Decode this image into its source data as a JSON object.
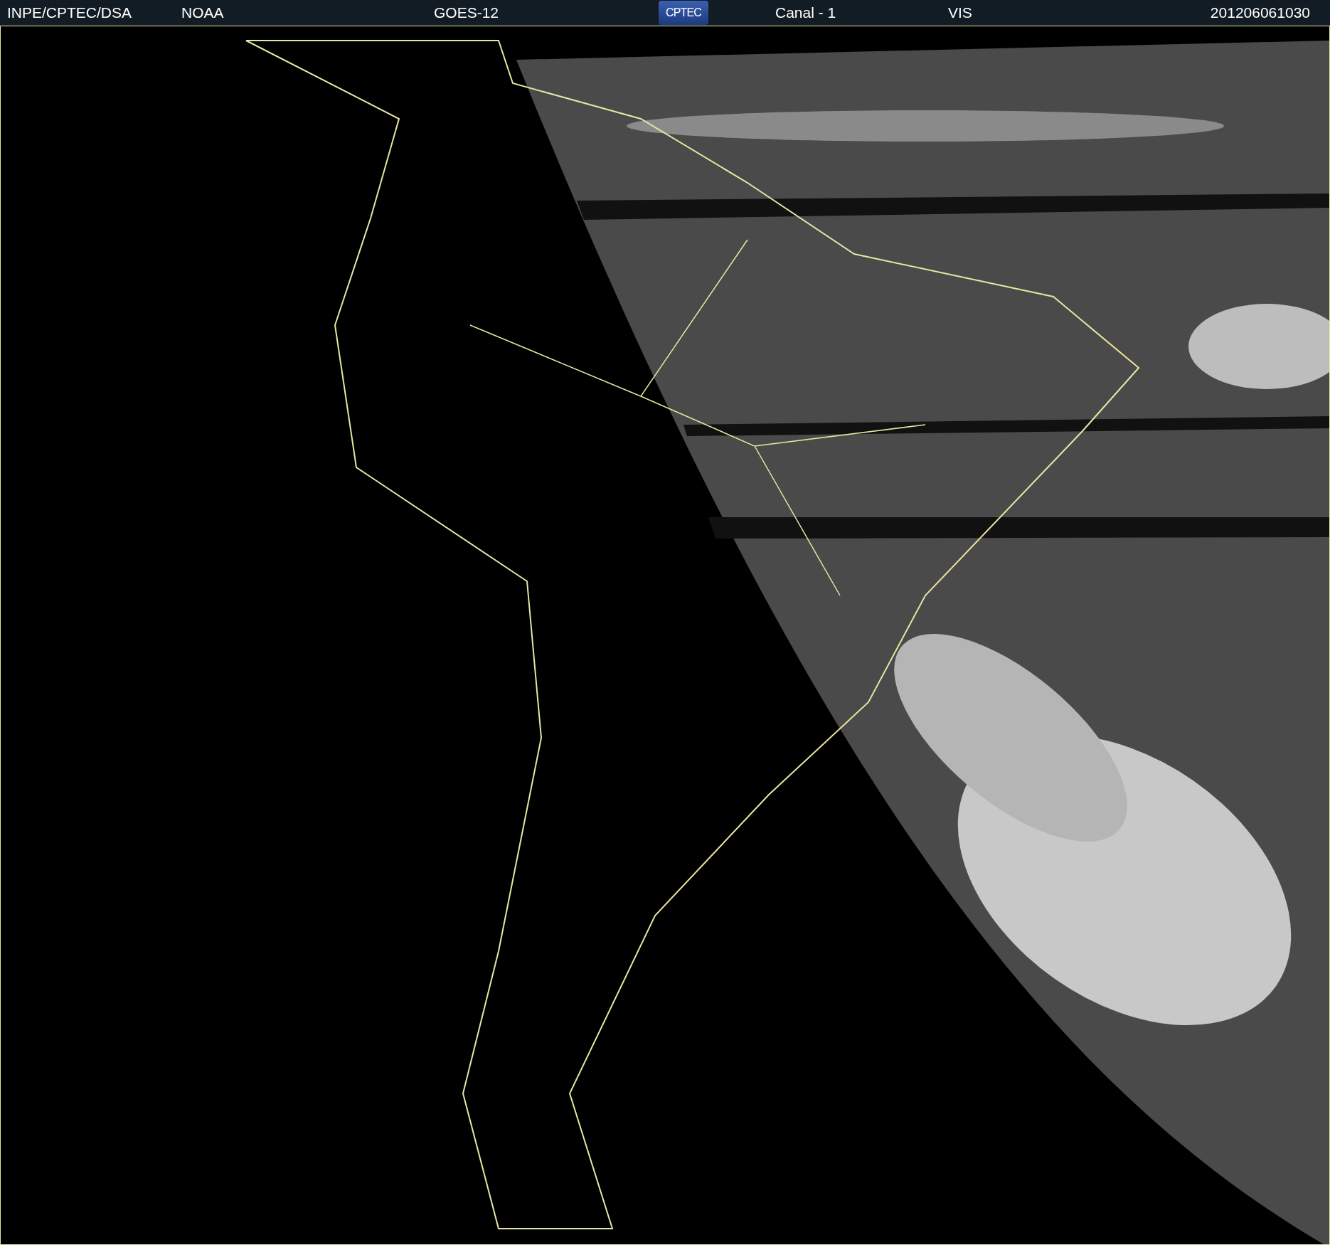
{
  "header": {
    "items": [
      {
        "kind": "text",
        "text": "INPE/CPTEC/DSA"
      },
      {
        "kind": "text",
        "text": "NOAA"
      },
      {
        "kind": "text",
        "text": "GOES-12"
      },
      {
        "kind": "logo",
        "text": "CPTEC"
      },
      {
        "kind": "text",
        "text": "Canal - 1"
      },
      {
        "kind": "text",
        "text": "VIS"
      },
      {
        "kind": "text",
        "text": "201206061030"
      }
    ]
  }
}
